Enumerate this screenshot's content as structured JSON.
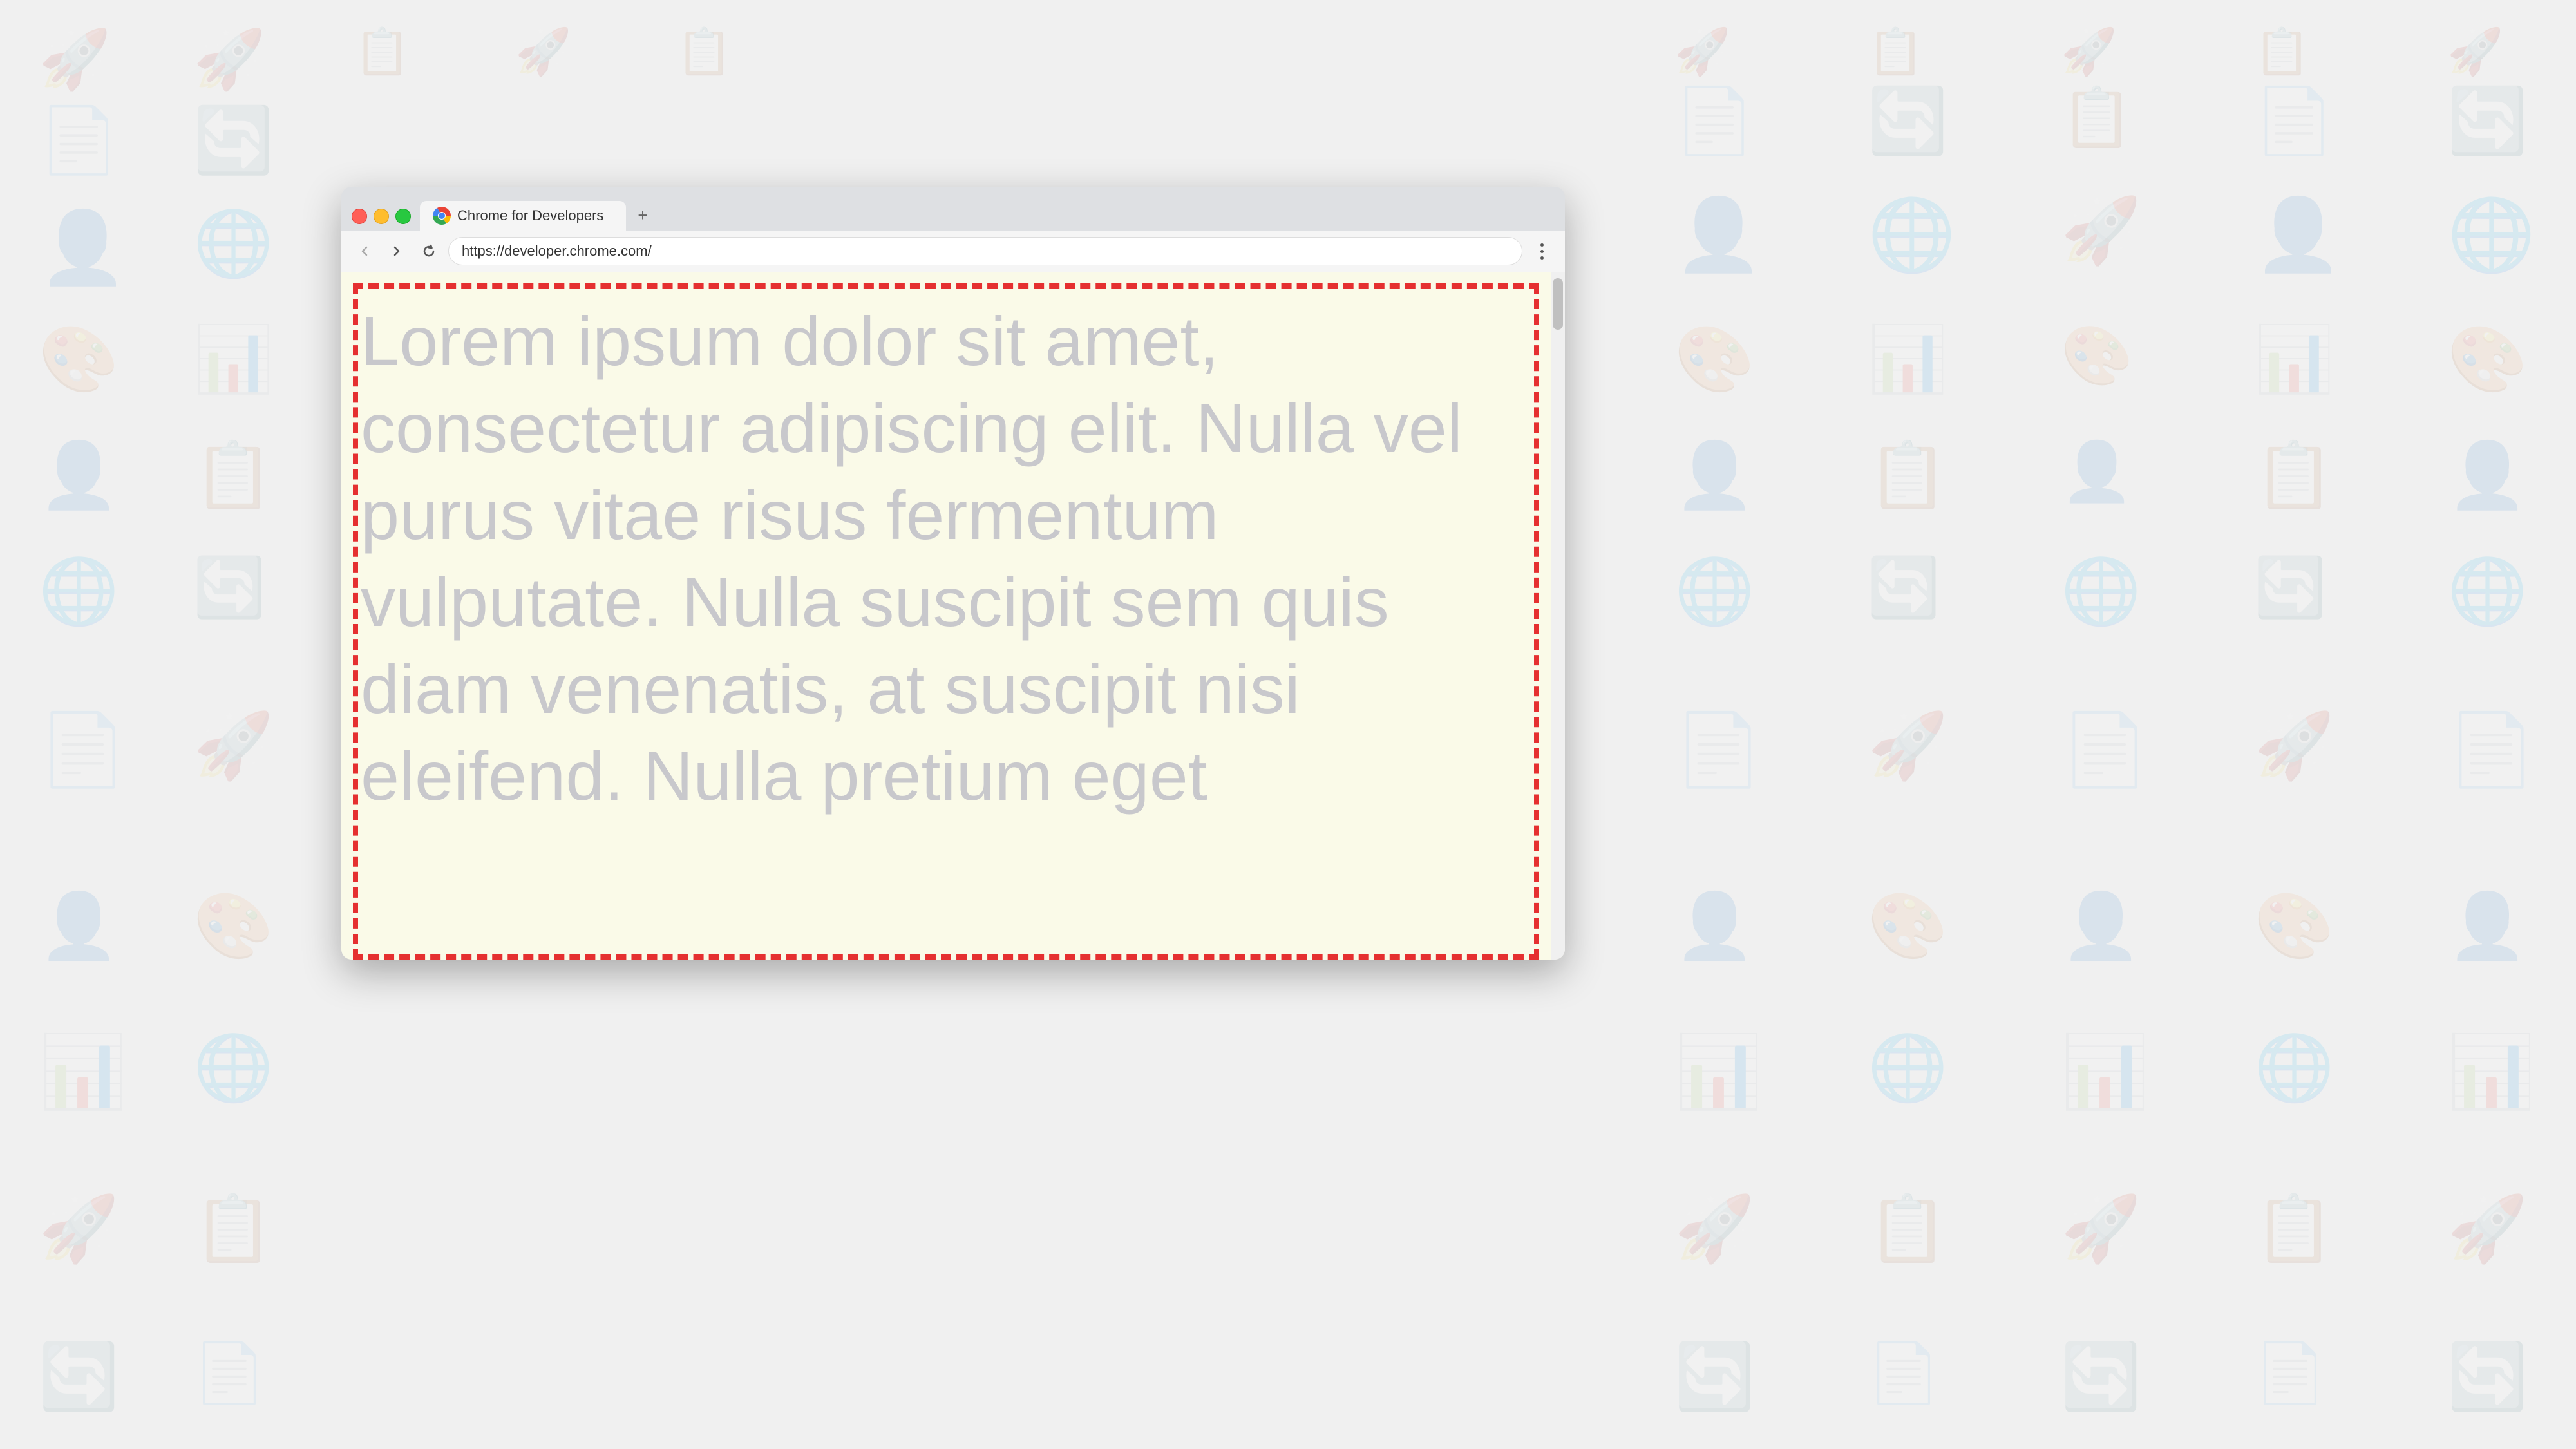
{
  "background": {
    "color": "#efefef"
  },
  "browser": {
    "tab": {
      "title": "Chrome for Developers",
      "favicon_alt": "chrome-logo",
      "add_button": "+"
    },
    "nav": {
      "back_icon": "←",
      "forward_icon": "→",
      "reload_icon": "↻",
      "url": "https://developer.chrome.com/",
      "menu_icon": "⋮"
    },
    "page": {
      "lorem_text": "Lorem ipsum dolor sit amet, consectetur adipiscing elit. Nulla vel purus vitae risus fermentum vulputate. Nulla suscipit sem quis diam venenatis, at suscipit nisi eleifend. Nulla pretium eget",
      "border_color": "#e53030",
      "bg_color": "#fafae8"
    }
  }
}
